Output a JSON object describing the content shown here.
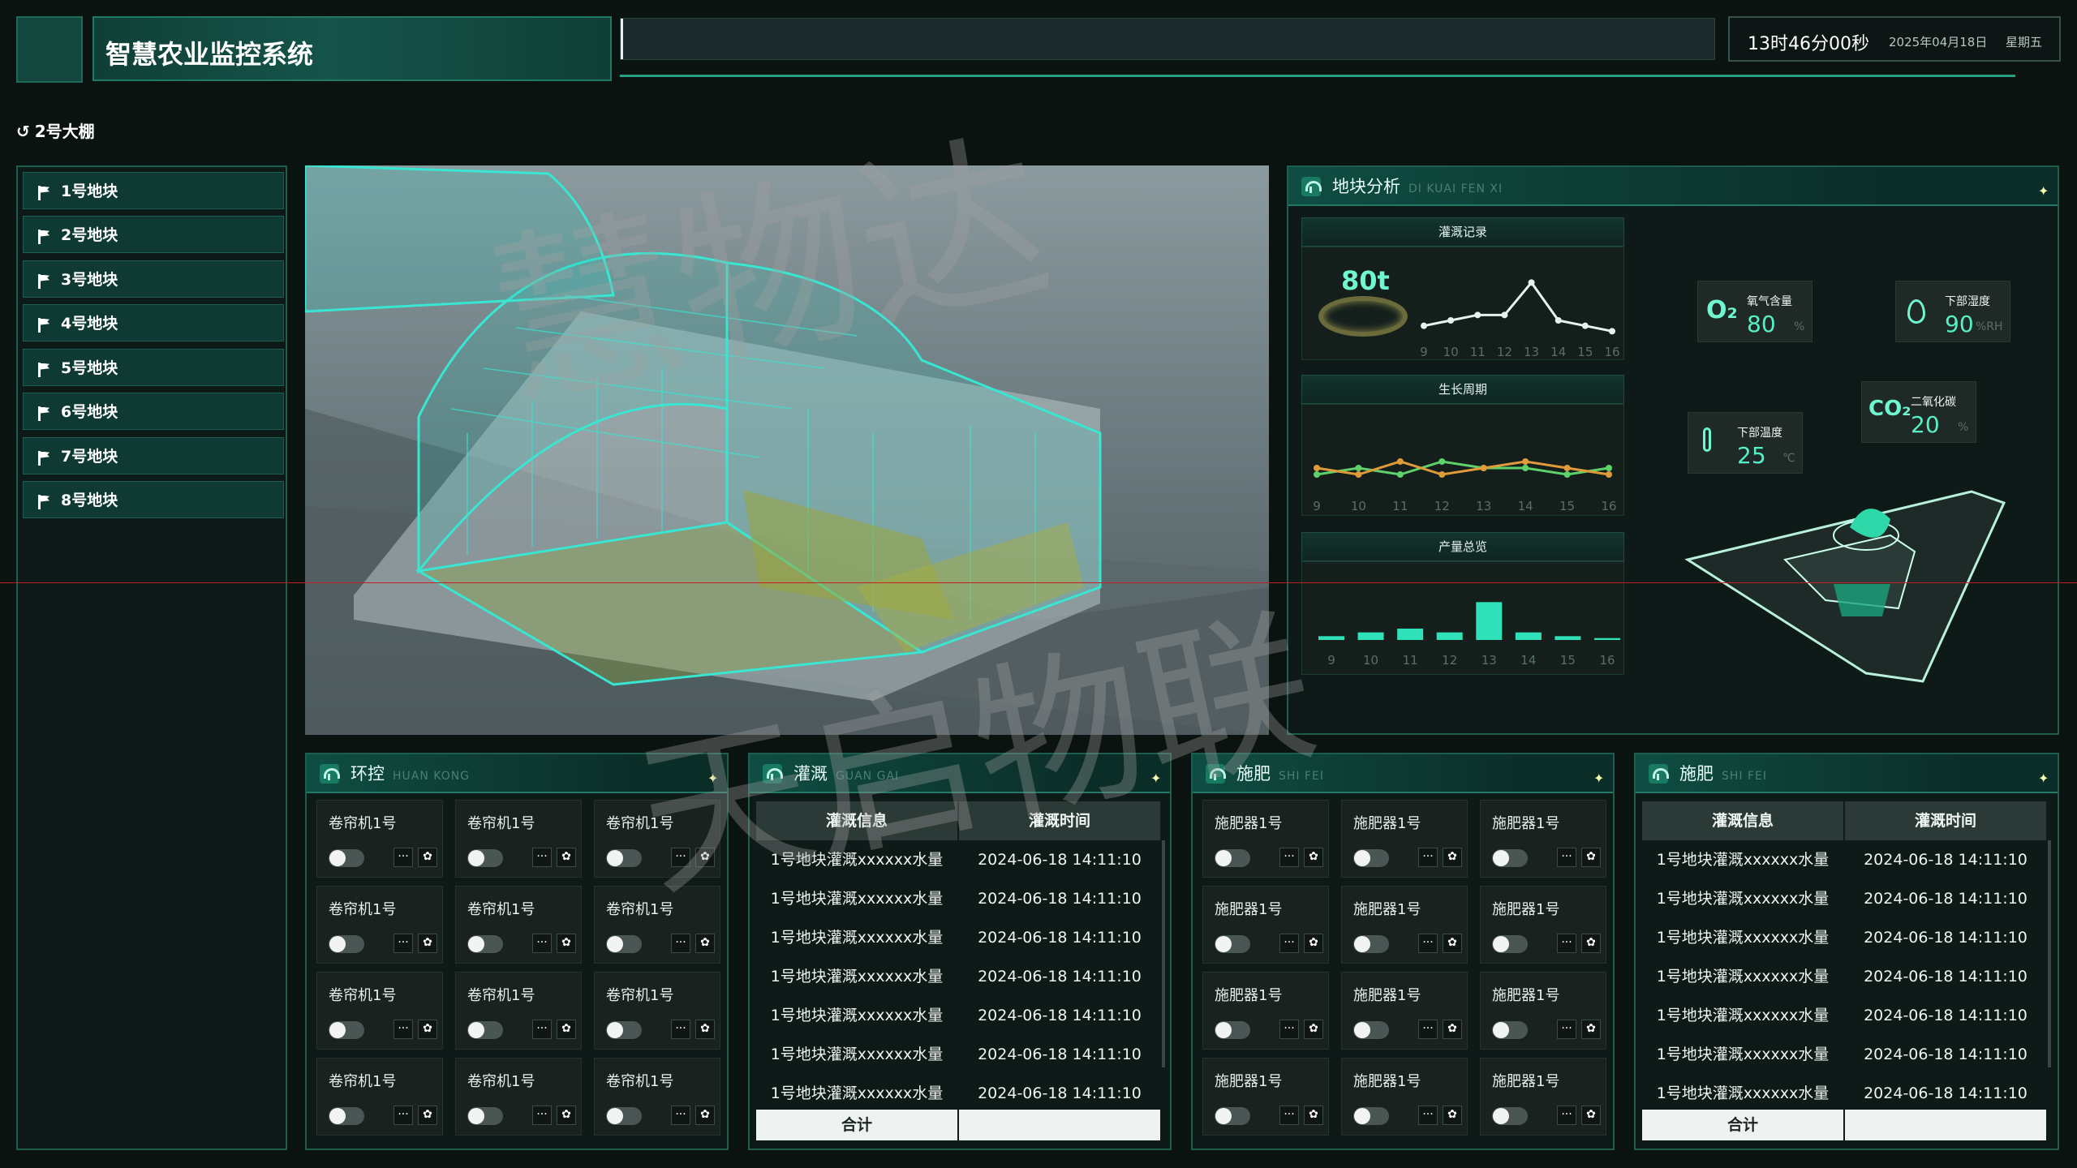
{
  "header": {
    "title": "智慧农业监控系统",
    "time": "13时46分00秒",
    "date": "2025年04月18日",
    "weekday": "星期五",
    "search_value": ""
  },
  "breadcrumb": {
    "label": "2号大棚"
  },
  "sidebar": {
    "items": [
      {
        "label": "1号地块"
      },
      {
        "label": "2号地块"
      },
      {
        "label": "3号地块"
      },
      {
        "label": "4号地块"
      },
      {
        "label": "5号地块"
      },
      {
        "label": "6号地块"
      },
      {
        "label": "7号地块"
      },
      {
        "label": "8号地块"
      }
    ]
  },
  "analysis": {
    "title": "地块分析",
    "title_en": "DI KUAI FEN XI",
    "irrigation_record": {
      "title": "灌溉记录",
      "value": "80t"
    },
    "growth_cycle": {
      "title": "生长周期"
    },
    "yield_overview": {
      "title": "产量总览"
    },
    "metrics": {
      "o2": {
        "symbol": "O₂",
        "name": "氧气含量",
        "value": "80",
        "unit": "%"
      },
      "humidity": {
        "name": "下部湿度",
        "value": "90",
        "unit": "%RH"
      },
      "co2": {
        "symbol": "CO₂",
        "name": "二氧化碳",
        "value": "20",
        "unit": "%"
      },
      "temperature": {
        "name": "下部温度",
        "value": "25",
        "unit": "℃"
      }
    }
  },
  "chart_data": [
    {
      "type": "line",
      "title": "灌溉记录",
      "x": [
        9,
        10,
        11,
        12,
        13,
        14,
        15,
        16
      ],
      "series": [
        {
          "values": [
            2,
            3,
            4,
            4,
            10,
            3,
            2,
            1
          ]
        }
      ],
      "ylim": [
        0,
        12
      ],
      "color": "#e6f2ee"
    },
    {
      "type": "line",
      "title": "生长周期",
      "x": [
        9,
        10,
        11,
        12,
        13,
        14,
        15,
        16
      ],
      "series": [
        {
          "values": [
            3,
            4,
            3,
            5,
            4,
            4,
            3,
            4
          ]
        },
        {
          "values": [
            4,
            3,
            5,
            3,
            4,
            5,
            4,
            3
          ]
        }
      ],
      "ylim": [
        0,
        10
      ],
      "colors": [
        "#5fd16b",
        "#e09a3a"
      ]
    },
    {
      "type": "bar",
      "title": "产量总览",
      "categories": [
        "9",
        "10",
        "11",
        "12",
        "13",
        "14",
        "15",
        "16"
      ],
      "values": [
        1,
        2,
        3,
        2,
        10,
        2,
        1,
        0.5
      ],
      "ylim": [
        0,
        12
      ],
      "color": "#2fe0b8"
    }
  ],
  "sections": {
    "env": {
      "title": "环控",
      "title_en": "HUAN KONG",
      "device_label": "卷帘机1号"
    },
    "irrigation": {
      "title": "灌溉",
      "title_en": "GUAN GAI"
    },
    "fert_ctrl": {
      "title": "施肥",
      "title_en": "SHI FEI",
      "device_label": "施肥器1号"
    },
    "fert_table": {
      "title": "施肥",
      "title_en": "SHI FEI"
    }
  },
  "table": {
    "col1": "灌溉信息",
    "col2": "灌溉时间",
    "rows": [
      {
        "info": "1号地块灌溉xxxxxx水量",
        "time": "2024-06-18 14:11:10"
      },
      {
        "info": "1号地块灌溉xxxxxx水量",
        "time": "2024-06-18 14:11:10"
      },
      {
        "info": "1号地块灌溉xxxxxx水量",
        "time": "2024-06-18 14:11:10"
      },
      {
        "info": "1号地块灌溉xxxxxx水量",
        "time": "2024-06-18 14:11:10"
      },
      {
        "info": "1号地块灌溉xxxxxx水量",
        "time": "2024-06-18 14:11:10"
      },
      {
        "info": "1号地块灌溉xxxxxx水量",
        "time": "2024-06-18 14:11:10"
      },
      {
        "info": "1号地块灌溉xxxxxx水量",
        "time": "2024-06-18 14:11:10"
      }
    ],
    "footer": "合计"
  },
  "icons": {
    "back": "back-arrow-icon",
    "flag": "flag-icon",
    "more": "more-icon",
    "settings": "gear-icon"
  },
  "watermarks": {
    "line1": "慧物达",
    "line2": "天启物联"
  }
}
